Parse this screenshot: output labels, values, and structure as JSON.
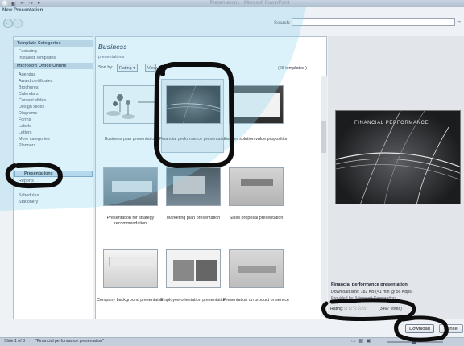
{
  "window": {
    "app_title": "Presentation1 - Microsoft PowerPoint",
    "qat_glyphs": "◧ ↶ ↷ ▾"
  },
  "dialog": {
    "title": "New Presentation",
    "nav_back": "←",
    "nav_forward": "→",
    "search_label": "Search:",
    "search_value": "",
    "search_icon": "→"
  },
  "sidebar": {
    "headers": [
      "Template Categories",
      "Microsoft Office Online"
    ],
    "top_items": [
      "Featuring",
      "Installed Templates"
    ],
    "items": [
      "Agendas",
      "Award certificates",
      "Brochures",
      "Calendars",
      "Content slides",
      "Design slides",
      "Diagrams",
      "Forms",
      "Labels",
      "Letters",
      "More categories",
      "Planners",
      "Presentations",
      "Reports",
      "Schedules",
      "Stationery"
    ],
    "selected_index": 12
  },
  "main": {
    "section_title": "Business",
    "section_subtitle": "presentations",
    "sort_label": "Sort by:",
    "sort_value": "Rating ▾",
    "view_label": "View",
    "template_count": "(28 templates )",
    "templates": [
      "Business plan presentation",
      "Financial performance presentation",
      "Partner solution value proposition",
      "Presentation for strategy recommendation",
      "Marketing plan presentation",
      "Sales proposal presentation",
      "Company background presentation",
      "Employee orientation presentation",
      "Presentation on product or service"
    ],
    "selected_index": 1
  },
  "preview": {
    "slide_title": "FINANCIAL PERFORMANCE",
    "name": "Financial performance presentation",
    "download_size": "Download size: 182 KB (<1 min @ 56 Kbps)",
    "provided_by": "Provided by: Microsoft Corporation",
    "rating_label": "Rating:",
    "rating_stars": "☆☆☆☆☆",
    "vote_count": "(3467 votes)"
  },
  "buttons": {
    "download": "Download",
    "cancel": "Cancel"
  },
  "statusbar": {
    "slide": "Slide 1 of 8",
    "theme": "\"Financial performance presentation\"",
    "view_icons": "▭ ▦ ▣"
  },
  "colors": {
    "marker": "#0d0d0d",
    "highlight": "#8fd8f0"
  }
}
